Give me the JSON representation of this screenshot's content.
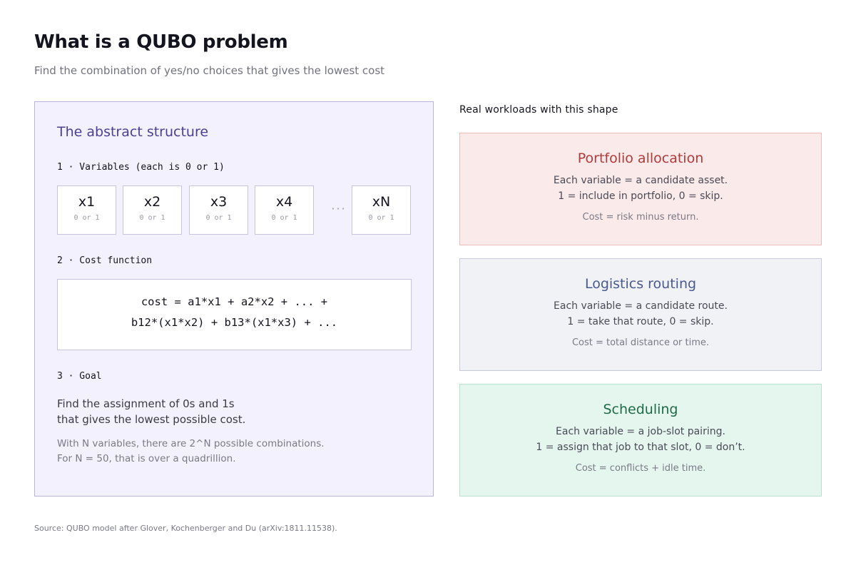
{
  "header": {
    "title": "What is a QUBO problem",
    "subtitle": "Find the combination of yes/no choices that gives the lowest cost"
  },
  "structure": {
    "title": "The abstract structure",
    "step1_label": "1 · Variables (each is 0 or 1)",
    "variables": [
      {
        "name": "x1",
        "domain": "0 or 1"
      },
      {
        "name": "x2",
        "domain": "0 or 1"
      },
      {
        "name": "x3",
        "domain": "0 or 1"
      },
      {
        "name": "x4",
        "domain": "0 or 1"
      },
      {
        "name": "xN",
        "domain": "0 or 1"
      }
    ],
    "ellipsis": "···",
    "step2_label": "2 · Cost function",
    "cost_line1": "cost = a1*x1 + a2*x2 + ... +",
    "cost_line2": "b12*(x1*x2) + b13*(x1*x3) + ...",
    "step3_label": "3 · Goal",
    "goal_line1": "Find the assignment of 0s and 1s",
    "goal_line2": "that gives the lowest possible cost.",
    "note_line1": "With N variables, there are 2^N possible combinations.",
    "note_line2": "For N = 50, that is over a quadrillion."
  },
  "workloads": {
    "heading": "Real workloads with this shape",
    "cards": [
      {
        "title": "Portfolio allocation",
        "line1": "Each variable = a candidate asset.",
        "line2": "1 = include in portfolio, 0 = skip.",
        "cost": "Cost = risk minus return."
      },
      {
        "title": "Logistics routing",
        "line1": "Each variable = a candidate route.",
        "line2": "1 = take that route, 0 = skip.",
        "cost": "Cost = total distance or time."
      },
      {
        "title": "Scheduling",
        "line1": "Each variable = a job-slot pairing.",
        "line2": "1 = assign that job to that slot, 0 = don’t.",
        "cost": "Cost = conflicts + idle time."
      }
    ]
  },
  "footer": {
    "source": "Source: QUBO model after Glover, Kochenberger and Du (arXiv:1811.11538)."
  },
  "colors": {
    "panel_bg": "#f3f1fd",
    "panel_accent": "#4d3e94",
    "portfolio": "#b23a3a",
    "logistics": "#4a5990",
    "scheduling": "#1f6b48"
  }
}
